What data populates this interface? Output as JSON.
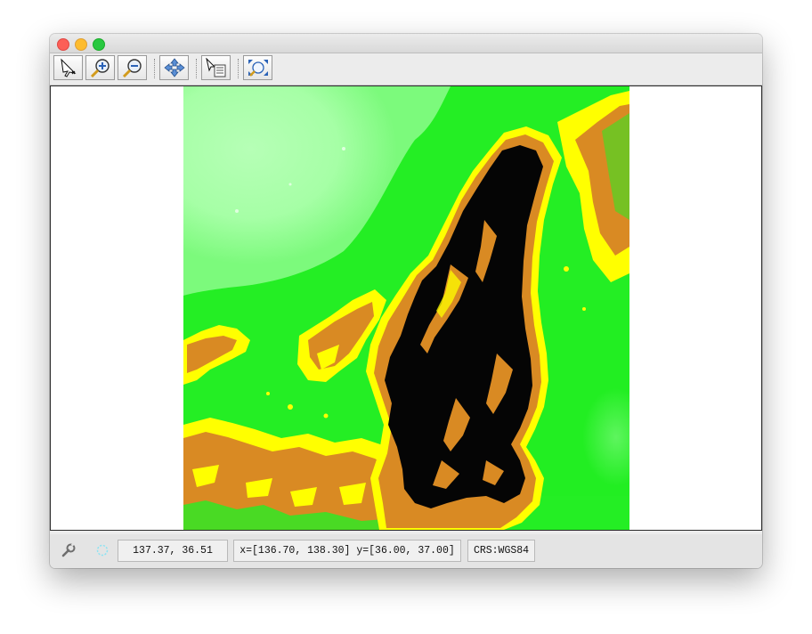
{
  "window": {
    "controls": [
      "close",
      "minimize",
      "zoom"
    ]
  },
  "toolbar": {
    "tools": [
      {
        "name": "select-tool",
        "icon": "pointer-arrow-icon"
      },
      {
        "name": "zoom-in-tool",
        "icon": "zoom-in-magnifier-icon"
      },
      {
        "name": "zoom-out-tool",
        "icon": "zoom-out-magnifier-icon"
      },
      {
        "name": "pan-tool",
        "icon": "four-way-arrows-icon"
      },
      {
        "name": "info-tool",
        "icon": "info-pointer-icon"
      },
      {
        "name": "reset-extent-tool",
        "icon": "full-extent-icon"
      }
    ]
  },
  "map": {
    "layer": "elevation-raster",
    "palette": {
      "lowland": "#a8ffa8",
      "plain": "#1ef01e",
      "hills": "#ffff00",
      "slopes": "#d98a23",
      "highland": "#000000"
    }
  },
  "status": {
    "settings_icon": "wrench-icon",
    "activity_icon": "spinner-icon",
    "cursor_position": "137.37, 36.51",
    "extent": "x=[136.70, 138.30] y=[36.00, 37.00]",
    "crs": "CRS:WGS84"
  }
}
